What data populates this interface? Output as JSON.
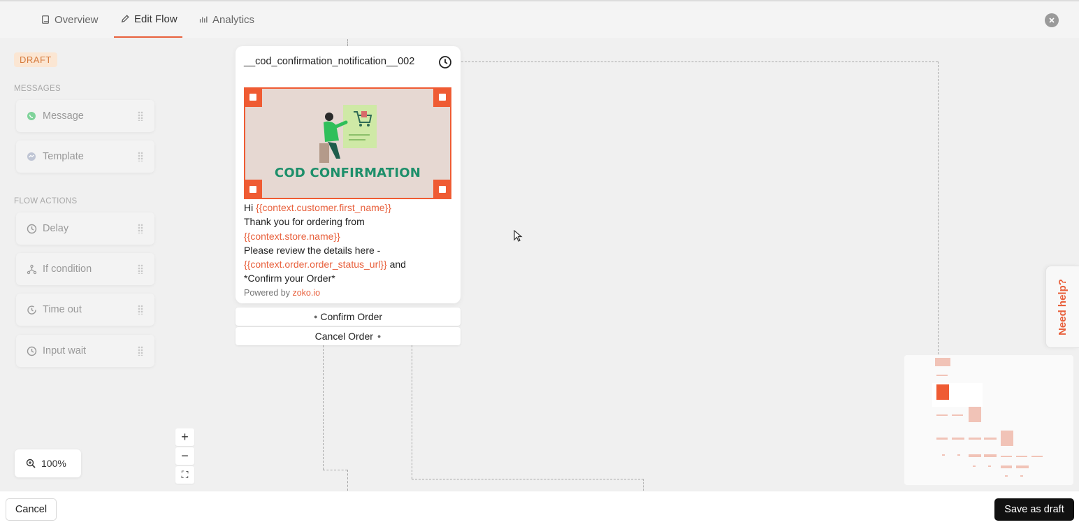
{
  "tabs": [
    {
      "label": "Overview",
      "icon": "book-icon"
    },
    {
      "label": "Edit Flow",
      "icon": "pencil-icon"
    },
    {
      "label": "Analytics",
      "icon": "bar-chart-icon"
    }
  ],
  "sidebar": {
    "badge": "DRAFT",
    "messages_label": "MESSAGES",
    "messages": [
      {
        "label": "Message",
        "icon": "whatsapp-icon"
      },
      {
        "label": "Template",
        "icon": "messenger-icon"
      }
    ],
    "actions_label": "FLOW ACTIONS",
    "actions": [
      {
        "label": "Delay",
        "icon": "clock-icon"
      },
      {
        "label": "If condition",
        "icon": "branch-icon"
      },
      {
        "label": "Time out",
        "icon": "timeout-icon"
      },
      {
        "label": "Input wait",
        "icon": "clock-icon"
      }
    ]
  },
  "node": {
    "title": "__cod_confirmation_notification__002",
    "image_text": "COD CONFIRMATION",
    "body": {
      "hi": "Hi ",
      "var_first_name": "{{context.customer.first_name}}",
      "thanks": "Thank you for ordering from",
      "var_store": "{{context.store.name}}",
      "review": "Please review the details here -",
      "var_url": "{{context.order.order_status_url}}",
      "and": " and",
      "confirm_line": "*Confirm your Order*",
      "powered_by": "Powered by ",
      "powered_link": "zoko.io"
    },
    "buttons": [
      "Confirm Order",
      "Cancel Order"
    ]
  },
  "zoom": {
    "level": "100%",
    "zoom_in": "+",
    "zoom_out": "−",
    "fit": "⛶"
  },
  "help": {
    "label": "Need help?"
  },
  "footer": {
    "cancel": "Cancel",
    "save": "Save as draft"
  },
  "colors": {
    "accent": "#e8603c",
    "draft_bg": "#fbe6d3",
    "save_bg": "#111111"
  }
}
